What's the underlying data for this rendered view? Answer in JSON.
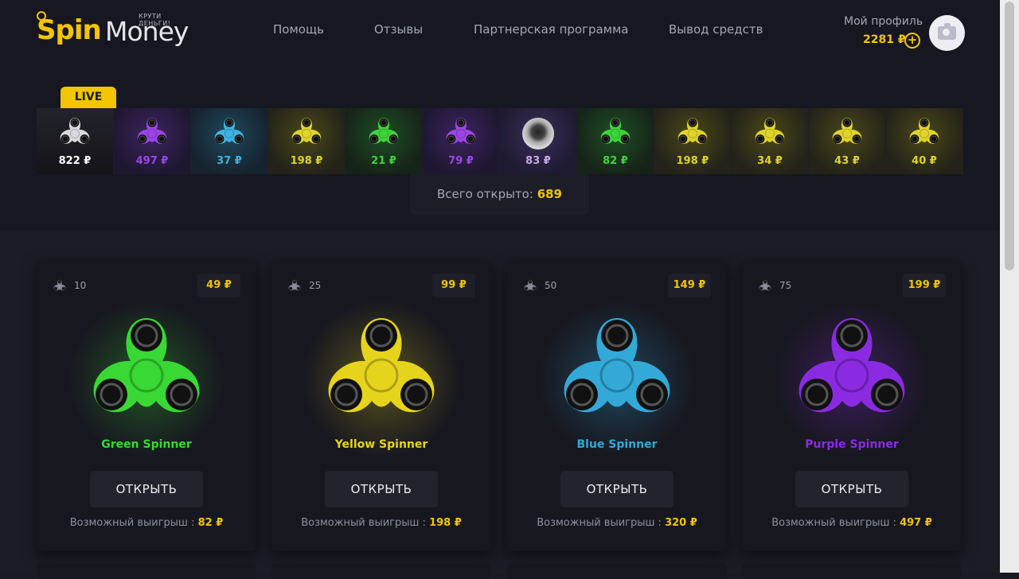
{
  "logo": {
    "brand_primary": "Spin",
    "brand_secondary": "Money",
    "tagline": "КРУТИ ДЕНЬГИ!"
  },
  "nav": {
    "items": [
      "Помощь",
      "Отзывы",
      "Партнерская программа",
      "Вывод средств"
    ]
  },
  "profile": {
    "label": "Мой профиль",
    "balance": "2281 ₽",
    "add_icon": "plus-circle-icon",
    "avatar_icon": "camera-icon"
  },
  "live": {
    "badge": "LIVE",
    "items": [
      {
        "amount": "822 ₽",
        "color": "white"
      },
      {
        "amount": "497 ₽",
        "color": "purple"
      },
      {
        "amount": "37 ₽",
        "color": "blue"
      },
      {
        "amount": "198 ₽",
        "color": "yellow"
      },
      {
        "amount": "21 ₽",
        "color": "green"
      },
      {
        "amount": "79 ₽",
        "color": "purple"
      },
      {
        "amount": "83 ₽",
        "color": "eye"
      },
      {
        "amount": "82 ₽",
        "color": "green"
      },
      {
        "amount": "198 ₽",
        "color": "yellow"
      },
      {
        "amount": "34 ₽",
        "color": "yellow"
      },
      {
        "amount": "43 ₽",
        "color": "yellow"
      },
      {
        "amount": "40 ₽",
        "color": "yellow"
      }
    ]
  },
  "total": {
    "label": "Всего открыто:",
    "value": "689"
  },
  "cards": [
    {
      "count": "10",
      "price": "49 ₽",
      "name": "Green Spinner",
      "button": "ОТКРЫТЬ",
      "win_label": "Возможный выигрыш :",
      "win_value": "82 ₽",
      "color": "#39d834"
    },
    {
      "count": "25",
      "price": "99 ₽",
      "name": "Yellow Spinner",
      "button": "ОТКРЫТЬ",
      "win_label": "Возможный выигрыш :",
      "win_value": "198 ₽",
      "color": "#e6d41c"
    },
    {
      "count": "50",
      "price": "149 ₽",
      "name": "Blue Spinner",
      "button": "ОТКРЫТЬ",
      "win_label": "Возможный выигрыш :",
      "win_value": "320 ₽",
      "color": "#33a9d8"
    },
    {
      "count": "75",
      "price": "199 ₽",
      "name": "Purple Spinner",
      "button": "ОТКРЫТЬ",
      "win_label": "Возможный выигрыш :",
      "win_value": "497 ₽",
      "color": "#8a2be2"
    }
  ],
  "colors": {
    "accent": "#f2c500",
    "white": "#d8d8de",
    "purple": "#9b45e6",
    "blue": "#3fb2e0",
    "yellow": "#e0d32a",
    "green": "#3cd43a",
    "eye": "#c9a8e8"
  }
}
